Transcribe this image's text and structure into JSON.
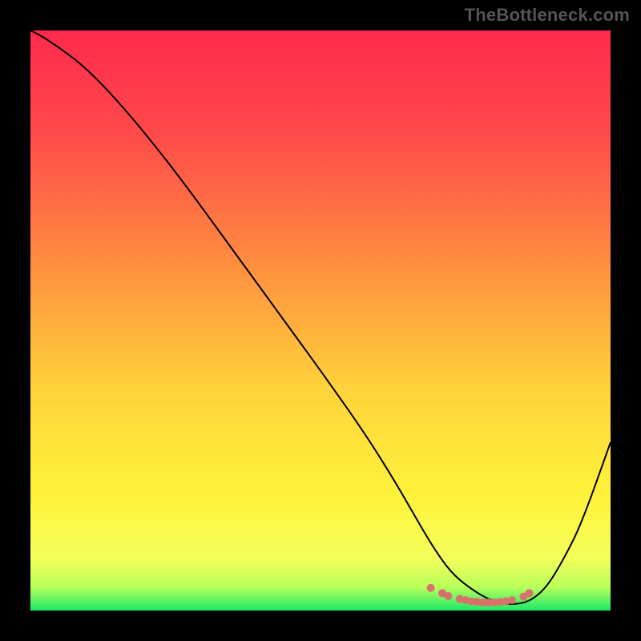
{
  "watermark": "TheBottleneck.com",
  "gradient": {
    "stops": [
      {
        "offset": "0%",
        "color": "#ff2a4d"
      },
      {
        "offset": "18%",
        "color": "#ff4a4a"
      },
      {
        "offset": "40%",
        "color": "#ff8d3f"
      },
      {
        "offset": "62%",
        "color": "#ffd33a"
      },
      {
        "offset": "80%",
        "color": "#fff23a"
      },
      {
        "offset": "91%",
        "color": "#f4ff5a"
      },
      {
        "offset": "96%",
        "color": "#b8ff5a"
      },
      {
        "offset": "100%",
        "color": "#1ce86a"
      }
    ]
  },
  "chart_data": {
    "type": "line",
    "title": "",
    "xlabel": "",
    "ylabel": "",
    "xlim": [
      0,
      100
    ],
    "ylim": [
      0,
      100
    ],
    "grid": false,
    "legend": false,
    "series": [
      {
        "name": "curve",
        "x": [
          0,
          2,
          5,
          9,
          14,
          20,
          27,
          35,
          43,
          51,
          58,
          63,
          67,
          70,
          73,
          77,
          80,
          83,
          86,
          89,
          92,
          95,
          100
        ],
        "y": [
          100,
          99,
          97,
          94,
          89,
          82,
          73,
          62,
          51,
          40,
          30,
          22,
          15,
          10,
          6,
          3,
          1.5,
          1,
          1.5,
          4,
          9,
          15,
          29
        ]
      }
    ],
    "markers": {
      "name": "highlight-dots",
      "x": [
        69,
        71,
        72,
        74,
        75,
        76,
        77,
        78,
        79,
        80,
        81,
        82,
        83,
        85,
        86
      ],
      "y": [
        3.9,
        3.0,
        2.5,
        2.0,
        1.8,
        1.6,
        1.5,
        1.4,
        1.4,
        1.4,
        1.5,
        1.6,
        1.8,
        2.4,
        3.0
      ]
    }
  }
}
